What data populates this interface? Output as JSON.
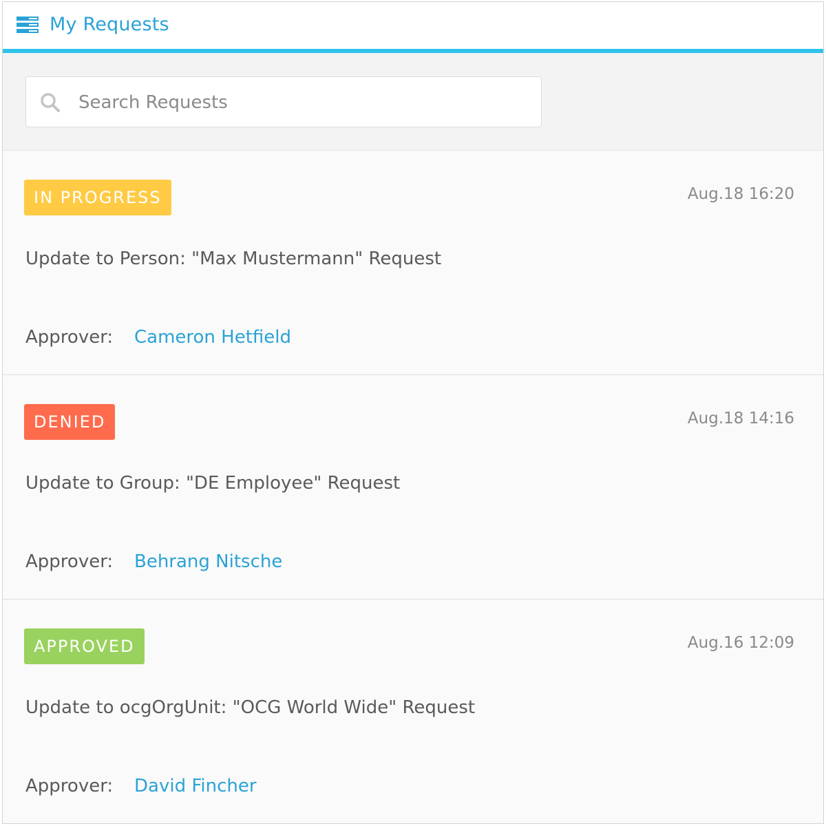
{
  "header": {
    "title": "My Requests",
    "icon": "menu-list-icon",
    "accent_color": "#2ec3ea"
  },
  "search": {
    "placeholder": "Search Requests",
    "value": "",
    "icon": "search-icon"
  },
  "requests": [
    {
      "status": "IN PROGRESS",
      "status_color": "#ffcb45",
      "timestamp": "Aug.18 16:20",
      "title": "Update to Person: \"Max Mustermann\" Request",
      "approver_label": "Approver:",
      "approver_name": "Cameron Hetfield"
    },
    {
      "status": "DENIED",
      "status_color": "#ff6b4d",
      "timestamp": "Aug.18 14:16",
      "title": "Update to Group: \"DE Employee\" Request",
      "approver_label": "Approver:",
      "approver_name": "Behrang Nitsche"
    },
    {
      "status": "APPROVED",
      "status_color": "#99d25e",
      "timestamp": "Aug.16 12:09",
      "title": "Update to ocgOrgUnit: \"OCG World Wide\" Request",
      "approver_label": "Approver:",
      "approver_name": "David Fincher"
    }
  ]
}
